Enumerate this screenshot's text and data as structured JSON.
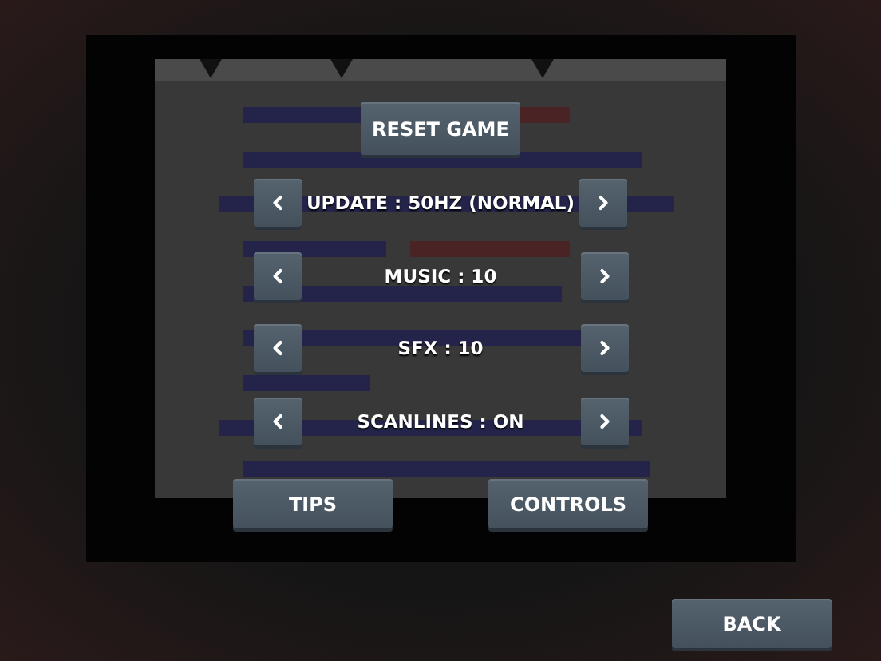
{
  "reset_button": "RESET GAME",
  "settings": [
    {
      "label": "UPDATE : 50HZ (NORMAL)"
    },
    {
      "label": "MUSIC : 10"
    },
    {
      "label": "SFX : 10"
    },
    {
      "label": "SCANLINES : ON"
    }
  ],
  "buttons": [
    "TIPS",
    "CONTROLS"
  ],
  "back_button": "BACK"
}
